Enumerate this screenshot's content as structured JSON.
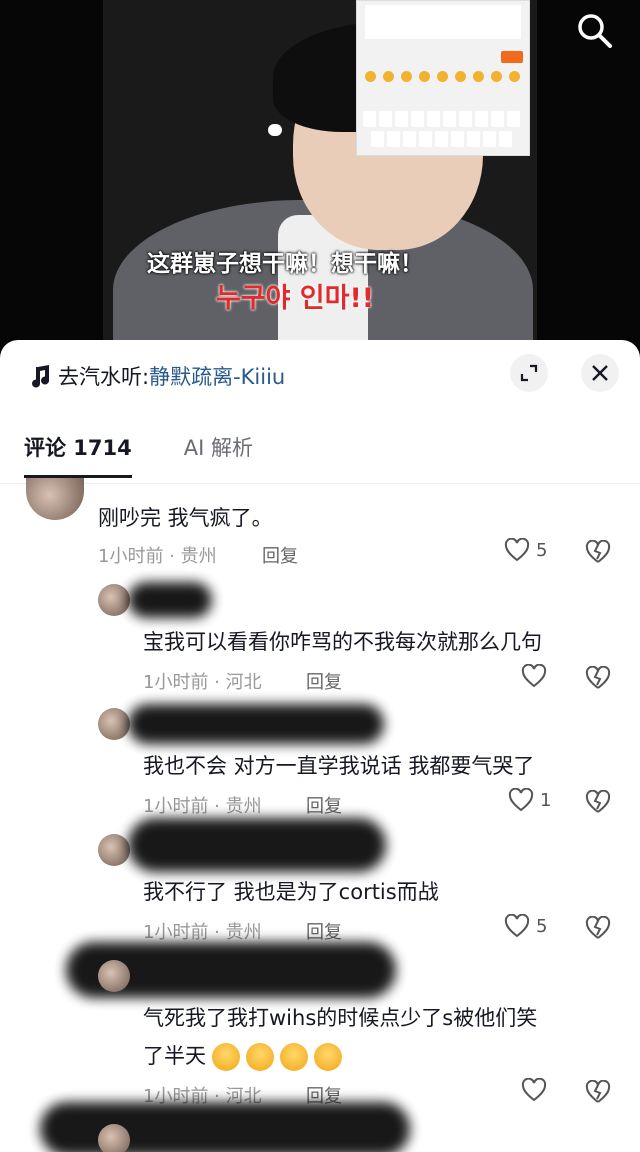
{
  "video": {
    "subtitle_cn": "这群崽子想干嘛！想干嘛！",
    "subtitle_kr": "누구야 인마!!"
  },
  "sheet": {
    "music_prefix": "去汽水听:",
    "music_title": "静默疏离-Kiiiu",
    "tabs": [
      {
        "label": "评论 1714"
      },
      {
        "label": "AI 解析"
      }
    ]
  },
  "comments": [
    {
      "text": "刚吵完 我气疯了。",
      "meta": "1小时前 · 贵州",
      "reply": "回复",
      "likes": "5"
    },
    {
      "text": "宝我可以看看你咋骂的不我每次就那么几句",
      "meta": "1小时前 · 河北",
      "reply": "回复",
      "likes": ""
    },
    {
      "text": "我也不会 对方一直学我说话 我都要气哭了",
      "meta": "1小时前 · 贵州",
      "reply": "回复",
      "likes": "1"
    },
    {
      "text": "我不行了 我也是为了cortis而战",
      "meta": "1小时前 · 贵州",
      "reply": "回复",
      "likes": "5"
    },
    {
      "text": "气死我了我打wihs的时候点少了s被他们笑",
      "text2": "了半天",
      "meta": "1小时前 · 河北",
      "reply": "回复",
      "likes": ""
    }
  ],
  "icons": {
    "search": "search-icon",
    "expand": "expand-icon",
    "close": "close-icon",
    "music": "music-note-icon",
    "like": "heart-outline-icon",
    "dislike": "broken-heart-icon",
    "emoji": "crying-face-emoji"
  },
  "colors": {
    "link": "#2a5a8c",
    "subtitle_kr": "#e22a2a",
    "meta": "#999999"
  }
}
